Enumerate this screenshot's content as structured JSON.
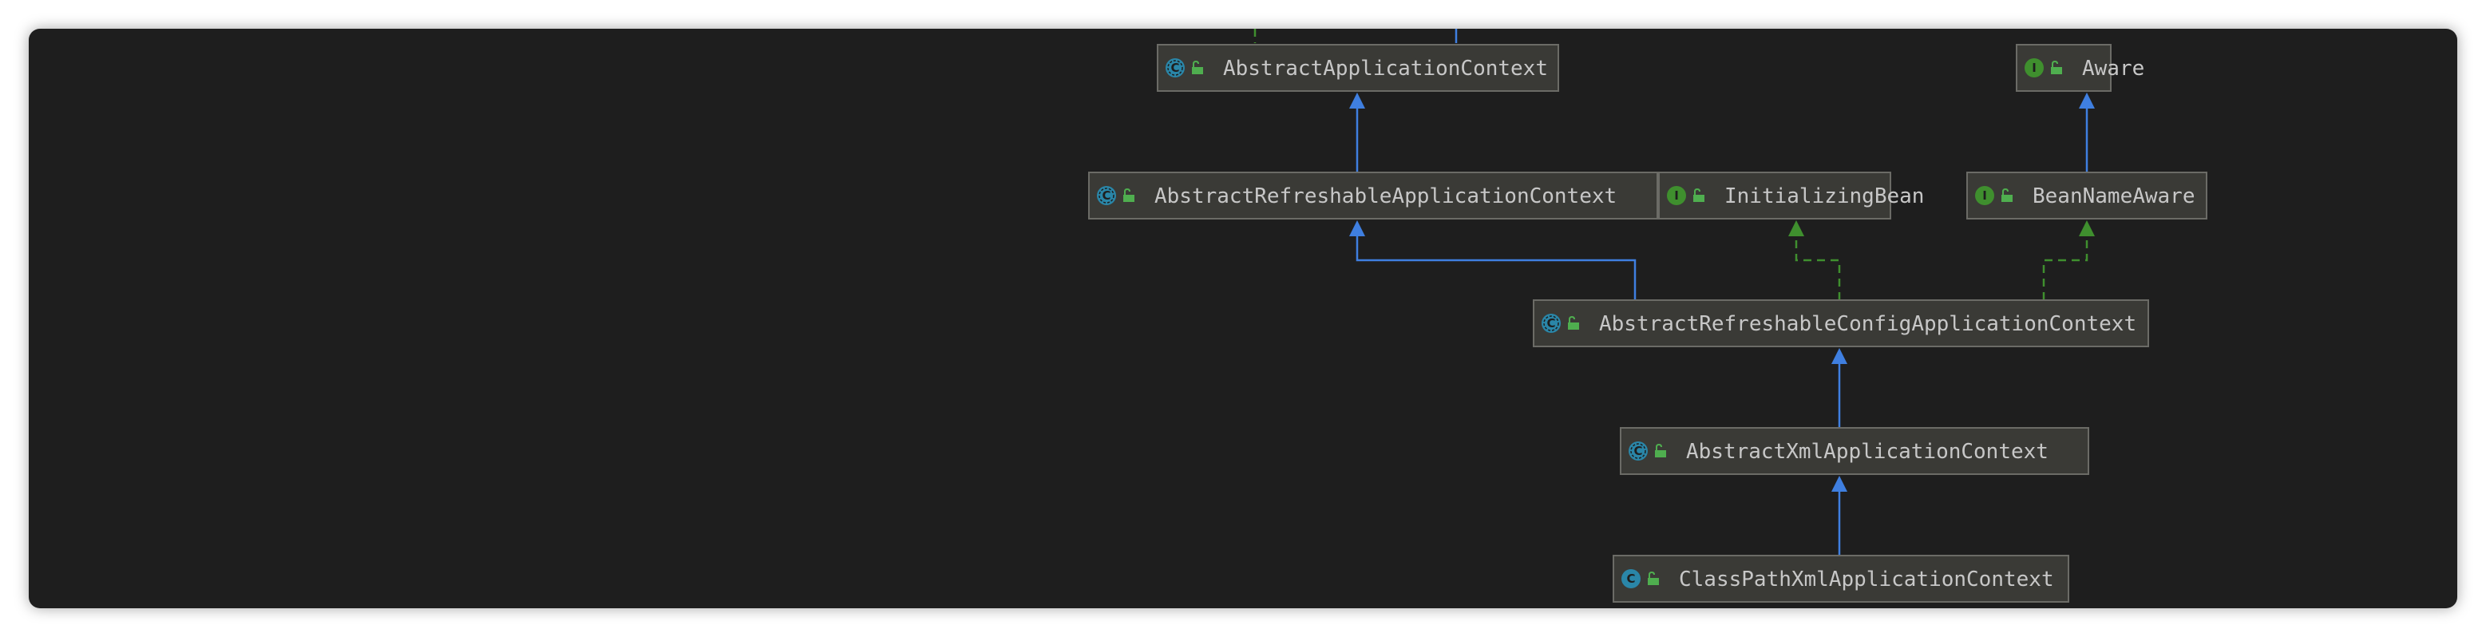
{
  "colors": {
    "frame_background": "#1e1e1e",
    "node_fill": "#3a3a36",
    "node_border": "#6b6b66",
    "label_text": "#c7c7c7",
    "extends_edge": "#3f7fe0",
    "implements_edge": "#3f8f2e",
    "class_badge": "#2a86a8",
    "abstract_badge": "#2a86a8",
    "interface_badge": "#3f8f2e",
    "lock_icon": "#4fae4f"
  },
  "nodes": [
    {
      "id": "aac",
      "label": "AbstractApplicationContext",
      "kind": "abstract-class",
      "icon": "abstract-class-icon",
      "badge": "C"
    },
    {
      "id": "aware",
      "label": "Aware",
      "kind": "interface",
      "icon": "interface-icon",
      "badge": "I"
    },
    {
      "id": "arac",
      "label": "AbstractRefreshableApplicationContext",
      "kind": "abstract-class",
      "icon": "abstract-class-icon",
      "badge": "C"
    },
    {
      "id": "ib",
      "label": "InitializingBean",
      "kind": "interface",
      "icon": "interface-icon",
      "badge": "I"
    },
    {
      "id": "bna",
      "label": "BeanNameAware",
      "kind": "interface",
      "icon": "interface-icon",
      "badge": "I"
    },
    {
      "id": "arcac",
      "label": "AbstractRefreshableConfigApplicationContext",
      "kind": "abstract-class",
      "icon": "abstract-class-icon",
      "badge": "C"
    },
    {
      "id": "axac",
      "label": "AbstractXmlApplicationContext",
      "kind": "abstract-class",
      "icon": "abstract-class-icon",
      "badge": "C"
    },
    {
      "id": "cpxac",
      "label": "ClassPathXmlApplicationContext",
      "kind": "class",
      "icon": "class-icon",
      "badge": "C"
    }
  ],
  "edges": [
    {
      "from": "arac",
      "to": "aac",
      "relation": "extends"
    },
    {
      "from": "bna",
      "to": "aware",
      "relation": "extends"
    },
    {
      "from": "arcac",
      "to": "arac",
      "relation": "extends"
    },
    {
      "from": "arcac",
      "to": "ib",
      "relation": "implements"
    },
    {
      "from": "arcac",
      "to": "bna",
      "relation": "implements"
    },
    {
      "from": "axac",
      "to": "arcac",
      "relation": "extends"
    },
    {
      "from": "cpxac",
      "to": "axac",
      "relation": "extends"
    }
  ]
}
